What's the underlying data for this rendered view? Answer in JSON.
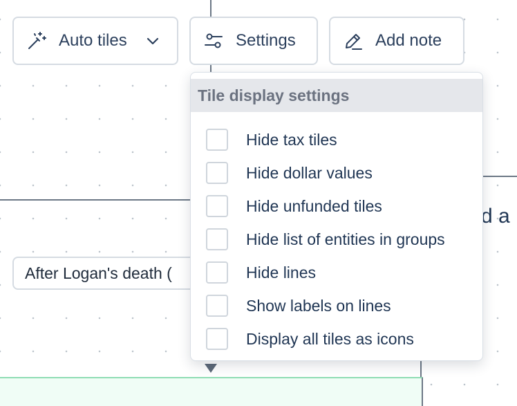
{
  "toolbar": {
    "auto_tiles_label": "Auto tiles",
    "settings_label": "Settings",
    "add_note_label": "Add note"
  },
  "canvas": {
    "node_label": "After Logan's death (",
    "partial_text": "d a"
  },
  "tile_settings": {
    "title": "Tile display settings",
    "options": [
      {
        "label": "Hide tax tiles",
        "checked": false
      },
      {
        "label": "Hide dollar values",
        "checked": false
      },
      {
        "label": "Hide unfunded tiles",
        "checked": false
      },
      {
        "label": "Hide list of entities in groups",
        "checked": false
      },
      {
        "label": "Hide lines",
        "checked": false
      },
      {
        "label": "Show labels on lines",
        "checked": false
      },
      {
        "label": "Display all tiles as icons",
        "checked": false
      }
    ]
  },
  "colors": {
    "text": "#1f3553",
    "border": "#d5dbe2",
    "header_bg": "#e5e7eb",
    "connector_line": "#6b7785",
    "green_fill": "#f0fdf6",
    "green_border": "#8fdcb3"
  },
  "icons": {
    "auto_tiles": "magic-wand-icon",
    "auto_tiles_caret": "chevron-down-icon",
    "settings": "sliders-icon",
    "add_note": "pencil-icon",
    "connector_end": "arrow-down-icon"
  }
}
